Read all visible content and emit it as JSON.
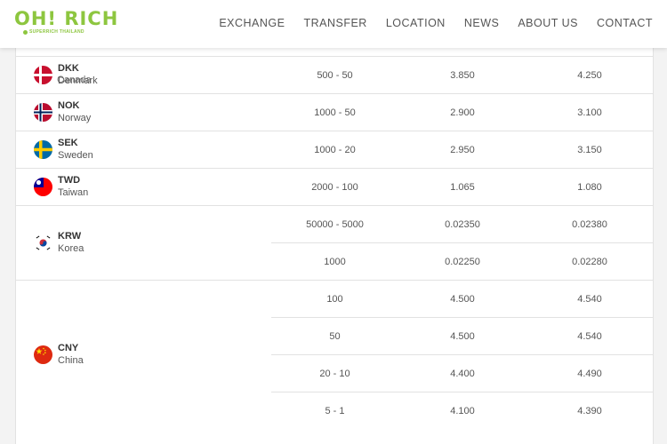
{
  "brand": {
    "logo": "OH! RICH",
    "tagline": "SUPERRICH THAILAND"
  },
  "nav": [
    "EXCHANGE",
    "TRANSFER",
    "LOCATION",
    "NEWS",
    "ABOUT US",
    "CONTACT"
  ],
  "partial_row_label": "Canada",
  "rows": [
    {
      "code": "DKK",
      "name": "Denmark",
      "flag": "denmark-flag-icon",
      "tiers": [
        {
          "denomination": "500 - 50",
          "buy": "3.850",
          "sell": "4.250"
        }
      ]
    },
    {
      "code": "NOK",
      "name": "Norway",
      "flag": "norway-flag-icon",
      "tiers": [
        {
          "denomination": "1000 - 50",
          "buy": "2.900",
          "sell": "3.100"
        }
      ]
    },
    {
      "code": "SEK",
      "name": "Sweden",
      "flag": "sweden-flag-icon",
      "tiers": [
        {
          "denomination": "1000 - 20",
          "buy": "2.950",
          "sell": "3.150"
        }
      ]
    },
    {
      "code": "TWD",
      "name": "Taiwan",
      "flag": "taiwan-flag-icon",
      "tiers": [
        {
          "denomination": "2000 - 100",
          "buy": "1.065",
          "sell": "1.080"
        }
      ]
    },
    {
      "code": "KRW",
      "name": "Korea",
      "flag": "korea-flag-icon",
      "tiers": [
        {
          "denomination": "50000 - 5000",
          "buy": "0.02350",
          "sell": "0.02380"
        },
        {
          "denomination": "1000",
          "buy": "0.02250",
          "sell": "0.02280"
        }
      ]
    },
    {
      "code": "CNY",
      "name": "China",
      "flag": "china-flag-icon",
      "tiers": [
        {
          "denomination": "100",
          "buy": "4.500",
          "sell": "4.540"
        },
        {
          "denomination": "50",
          "buy": "4.500",
          "sell": "4.540"
        },
        {
          "denomination": "20 - 10",
          "buy": "4.400",
          "sell": "4.490"
        },
        {
          "denomination": "5 - 1",
          "buy": "4.100",
          "sell": "4.390"
        }
      ]
    }
  ],
  "colors": {
    "brand_green": "#8dc63f",
    "border": "#e2e2e2"
  }
}
